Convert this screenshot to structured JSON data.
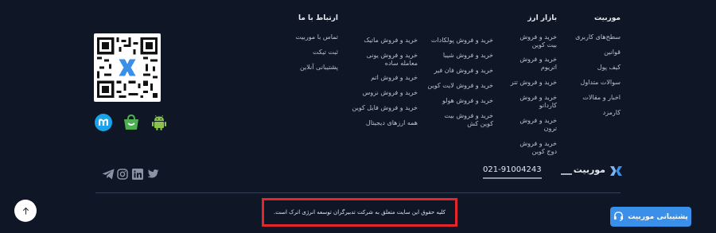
{
  "footer": {
    "columns": [
      {
        "title": "موربیت",
        "items": [
          "سطح‌های کاربری",
          "قوانین",
          "کیف پول",
          "سوالات متداول",
          "اخبار و مقالات",
          "کارمزد"
        ]
      },
      {
        "title": "بازار ارز",
        "items": [
          "خرید و فروش بیت کوین",
          "خرید و فروش اتریوم",
          "خرید و فروش تتر",
          "خرید و فروش کاردانو",
          "خرید و فروش ترون",
          "خرید و فروش دوج کوین"
        ]
      },
      {
        "items": [
          "خرید و فروش پولکادات",
          "خرید و فروش شیبا",
          "خرید و فروش فان فیر",
          "خرید و فروش لایت کوین",
          "خرید و فروش هولو",
          "خرید و فروش بیت کوین کش"
        ]
      },
      {
        "items": [
          "خرید و فروش ماتیک",
          "خرید و فروش یونی معامله ساده",
          "خرید و فروش اتم",
          "خرید و فروش نزوس",
          "خرید و فروش فایل کوین",
          "همه ارزهای دیجیتال"
        ]
      },
      {
        "title": "ارتباط با ما",
        "items": [
          "تماس با موربیت",
          "ثبت تیکت",
          "پشتیبانی آنلاین"
        ]
      }
    ],
    "phone": "021-91004243",
    "brand_name": "موربیت",
    "copyright": "کلیه حقوق این سایت متعلق به شرکت تدبیرگران توسعه انرژی اترک است.",
    "support_button_label": "پشتیبانی موربیت",
    "apps": [
      "myket-icon",
      "bazaar-icon",
      "android-icon"
    ],
    "socials": [
      "telegram-icon",
      "instagram-icon",
      "linkedin-icon",
      "twitter-icon"
    ],
    "colors": {
      "background": "#0f1726",
      "accent": "#3a8fe8",
      "highlight_box": "#e3262b",
      "android": "#8bc34a",
      "bazaar": "#4caf50",
      "myket": "#1aa3e8"
    }
  }
}
